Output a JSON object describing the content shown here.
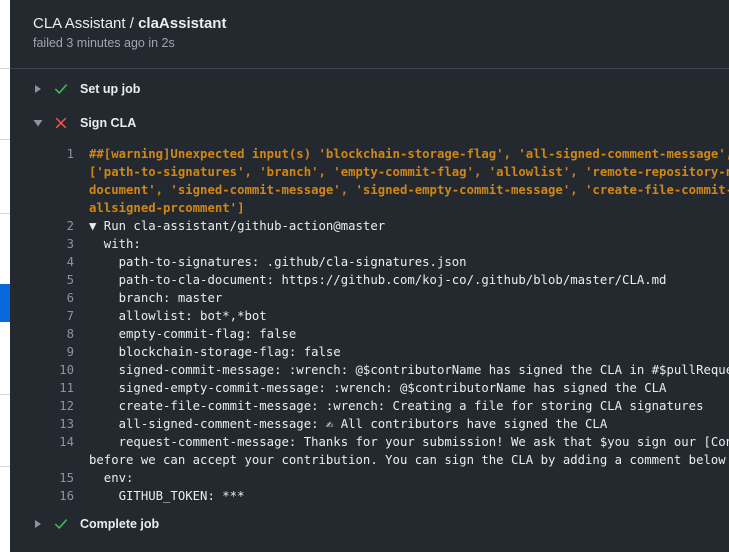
{
  "header": {
    "workflow": "CLA Assistant",
    "separator": " / ",
    "job": "claAssistant",
    "status_line": "failed 3 minutes ago in 2s"
  },
  "steps": [
    {
      "label": "Set up job",
      "state": "success",
      "expanded": false,
      "icon": "check-icon"
    },
    {
      "label": "Sign CLA",
      "state": "failure",
      "expanded": true,
      "icon": "x-icon"
    },
    {
      "label": "Complete job",
      "state": "success",
      "expanded": false,
      "icon": "check-icon"
    }
  ],
  "colors": {
    "success": "#3fb950",
    "failure": "#f85149",
    "warning": "#d18616",
    "panel": "#24292f"
  },
  "log": [
    {
      "num": "1",
      "text": "##[warning]Unexpected input(s) 'blockchain-storage-flag', 'all-signed-comment-message', 'r",
      "warn": true
    },
    {
      "num": "",
      "text": "['path-to-signatures', 'branch', 'empty-commit-flag', 'allowlist', 'remote-repository-name",
      "warn": true
    },
    {
      "num": "",
      "text": "document', 'signed-commit-message', 'signed-empty-commit-message', 'create-file-commit-mess",
      "warn": true
    },
    {
      "num": "",
      "text": "allsigned-prcomment']",
      "warn": true
    },
    {
      "num": "2",
      "text": "▼ Run cla-assistant/github-action@master"
    },
    {
      "num": "3",
      "text": "  with:"
    },
    {
      "num": "4",
      "text": "    path-to-signatures: .github/cla-signatures.json"
    },
    {
      "num": "5",
      "text": "    path-to-cla-document: https://github.com/koj-co/.github/blob/master/CLA.md"
    },
    {
      "num": "6",
      "text": "    branch: master"
    },
    {
      "num": "7",
      "text": "    allowlist: bot*,*bot"
    },
    {
      "num": "8",
      "text": "    empty-commit-flag: false"
    },
    {
      "num": "9",
      "text": "    blockchain-storage-flag: false"
    },
    {
      "num": "10",
      "text": "    signed-commit-message: :wrench: @$contributorName has signed the CLA in #$pullRequestNo"
    },
    {
      "num": "11",
      "text": "    signed-empty-commit-message: :wrench: @$contributorName has signed the CLA"
    },
    {
      "num": "12",
      "text": "    create-file-commit-message: :wrench: Creating a file for storing CLA signatures"
    },
    {
      "num": "13",
      "text": "    all-signed-comment-message: ✍ All contributors have signed the CLA"
    },
    {
      "num": "14",
      "text": "    request-comment-message: Thanks for your submission! We ask that $you sign our [Contri"
    },
    {
      "num": "",
      "text": "before we can accept your contribution. You can sign the CLA by adding a comment below usi"
    },
    {
      "num": "15",
      "text": "  env:"
    },
    {
      "num": "16",
      "text": "    GITHUB_TOKEN: ***"
    }
  ]
}
